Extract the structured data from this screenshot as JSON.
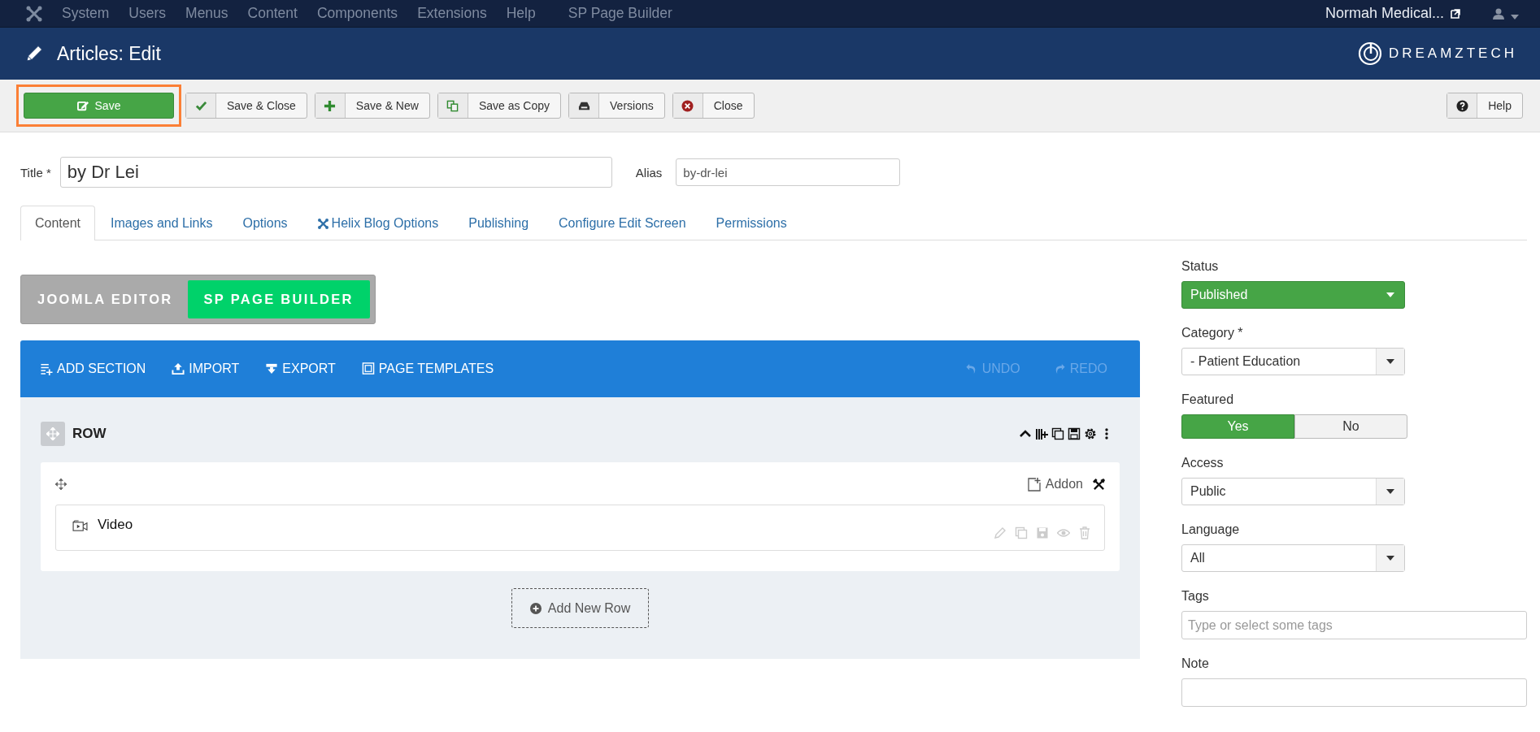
{
  "top_menu": {
    "items": [
      "System",
      "Users",
      "Menus",
      "Content",
      "Components",
      "Extensions",
      "Help",
      "SP Page Builder"
    ],
    "site_link": "Normah Medical..."
  },
  "header": {
    "title": "Articles: Edit",
    "logo": "DREAMZTECH"
  },
  "toolbar": {
    "buttons": [
      {
        "label": "Save",
        "kind": "save",
        "highlighted": true
      },
      {
        "label": "Save & Close",
        "kind": "check",
        "highlighted": false
      },
      {
        "label": "Save & New",
        "kind": "plus",
        "highlighted": false
      },
      {
        "label": "Save as Copy",
        "kind": "copy",
        "highlighted": false
      },
      {
        "label": "Versions",
        "kind": "versions",
        "highlighted": false
      },
      {
        "label": "Close",
        "kind": "close",
        "highlighted": false
      }
    ],
    "help": {
      "label": "Help",
      "kind": "help"
    }
  },
  "form": {
    "title": {
      "label": "Title *",
      "value": "by Dr Lei"
    },
    "alias": {
      "label": "Alias",
      "value": "by-dr-lei"
    }
  },
  "tabs": [
    {
      "label": "Content",
      "selected": true,
      "kind": "plain"
    },
    {
      "label": "Images and Links",
      "selected": false,
      "kind": "plain"
    },
    {
      "label": "Options",
      "selected": false,
      "kind": "plain"
    },
    {
      "label": "Helix Blog Options",
      "selected": false,
      "kind": "joomla"
    },
    {
      "label": "Publishing",
      "selected": false,
      "kind": "plain"
    },
    {
      "label": "Configure Edit Screen",
      "selected": false,
      "kind": "plain"
    },
    {
      "label": "Permissions",
      "selected": false,
      "kind": "plain"
    }
  ],
  "editor_switch": [
    {
      "label": "JOOMLA EDITOR",
      "selected": false
    },
    {
      "label": "SP PAGE BUILDER",
      "selected": true
    }
  ],
  "builder": {
    "actions": [
      {
        "label": "ADD SECTION",
        "kind": "section",
        "disabled": false
      },
      {
        "label": "IMPORT",
        "kind": "import",
        "disabled": false
      },
      {
        "label": "EXPORT",
        "kind": "export",
        "disabled": false
      },
      {
        "label": "PAGE TEMPLATES",
        "kind": "templates",
        "disabled": false
      }
    ],
    "history": [
      {
        "label": "UNDO",
        "kind": "undo",
        "disabled": true
      },
      {
        "label": "REDO",
        "kind": "redo",
        "disabled": true
      }
    ],
    "row": {
      "label": "ROW",
      "add_label": "Addon",
      "addons": [
        {
          "label": "Video"
        }
      ]
    },
    "add_row": "Add New Row"
  },
  "sidebar": {
    "fields": [
      {
        "label": "Status",
        "kind": "select",
        "value": "Published",
        "colored": true
      },
      {
        "label": "Category *",
        "kind": "select",
        "value": "- Patient Education",
        "colored": false
      },
      {
        "label": "Featured",
        "kind": "toggle",
        "options": [
          {
            "label": "Yes",
            "selected": true
          },
          {
            "label": "No",
            "selected": false
          }
        ]
      },
      {
        "label": "Access",
        "kind": "select",
        "value": "Public",
        "colored": false
      },
      {
        "label": "Language",
        "kind": "select",
        "value": "All",
        "colored": false
      },
      {
        "label": "Tags",
        "kind": "text",
        "placeholder": "Type or select some tags"
      },
      {
        "label": "Note",
        "kind": "text"
      }
    ]
  }
}
